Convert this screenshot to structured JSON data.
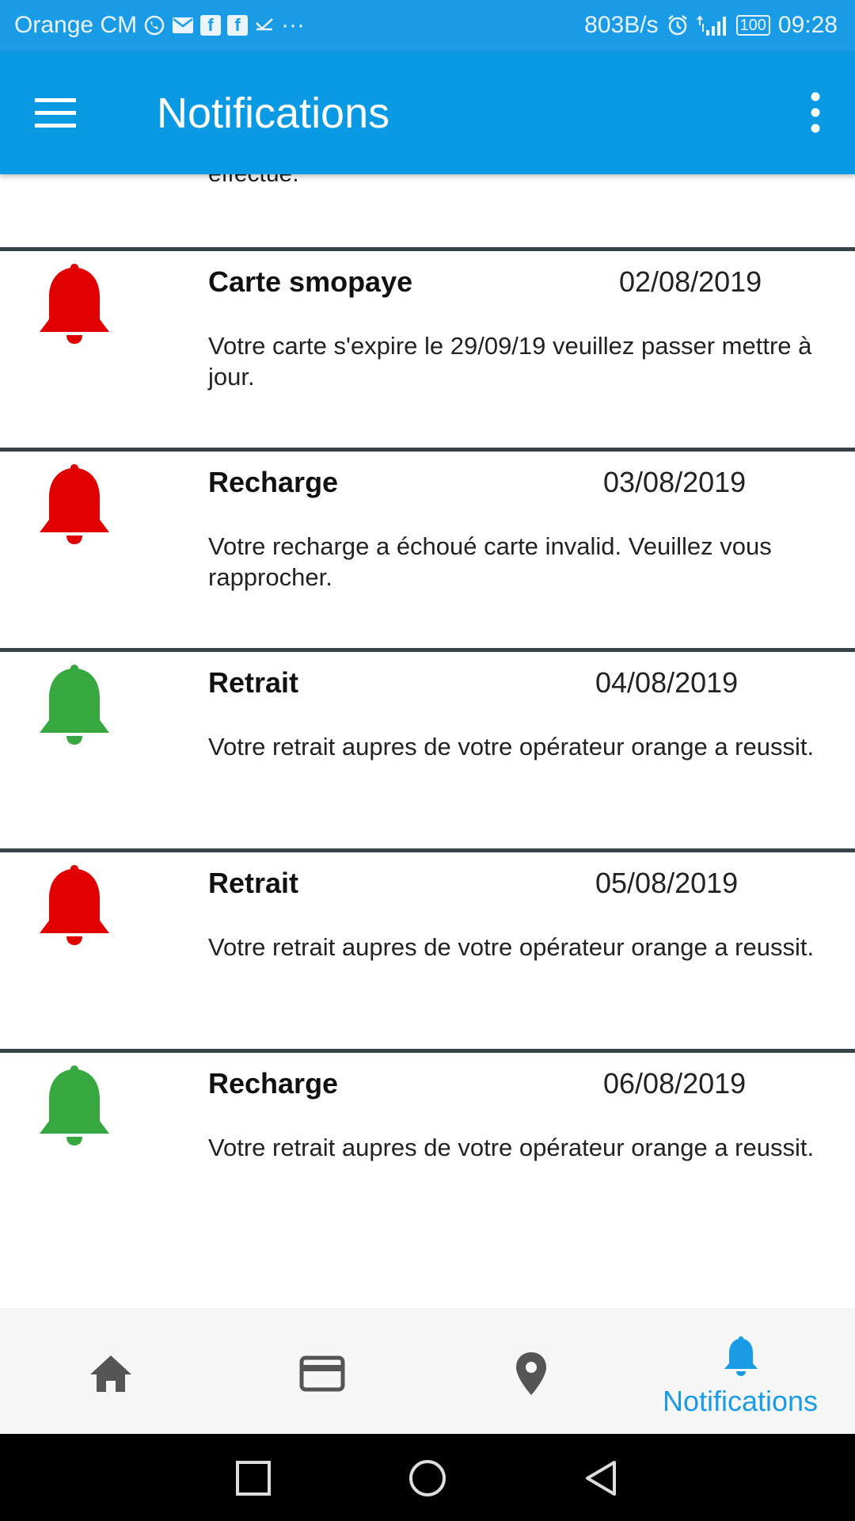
{
  "status_bar": {
    "carrier": "Orange CM",
    "more": "···",
    "speed": "803B/s",
    "battery": "100",
    "time": "09:28"
  },
  "app_bar": {
    "title": "Notifications"
  },
  "partial_item": {
    "message_tail": "effectue."
  },
  "notifications": [
    {
      "title": "Carte smopaye",
      "date": "02/08/2019",
      "message": "Votre carte s'expire le 29/09/19 veuillez passer mettre à jour.",
      "bell_color": "#e00000"
    },
    {
      "title": "Recharge",
      "date": "03/08/2019",
      "message": "Votre recharge a échoué carte invalid. Veuillez vous rapprocher.",
      "bell_color": "#e00000"
    },
    {
      "title": "Retrait",
      "date": "04/08/2019",
      "message": "Votre retrait aupres de votre opérateur orange a reussit.",
      "bell_color": "#36a83f"
    },
    {
      "title": "Retrait",
      "date": "05/08/2019",
      "message": "Votre retrait aupres de votre opérateur orange a reussit.",
      "bell_color": "#e00000"
    },
    {
      "title": "Recharge",
      "date": "06/08/2019",
      "message": "Votre retrait aupres de votre opérateur orange a reussit.",
      "bell_color": "#36a83f"
    }
  ],
  "bottom_nav": {
    "items": [
      {
        "icon": "home-icon",
        "label": ""
      },
      {
        "icon": "card-icon",
        "label": ""
      },
      {
        "icon": "location-pin-icon",
        "label": ""
      },
      {
        "icon": "bell-icon",
        "label": "Notifications",
        "active": true
      }
    ],
    "active_color": "#1a9be6",
    "inactive_color": "#555555"
  },
  "colors": {
    "status_bar": "#1a9be6",
    "app_bar": "#0a9ae3",
    "divider": "#37434b",
    "bell_red": "#e00000",
    "bell_green": "#36a83f"
  }
}
